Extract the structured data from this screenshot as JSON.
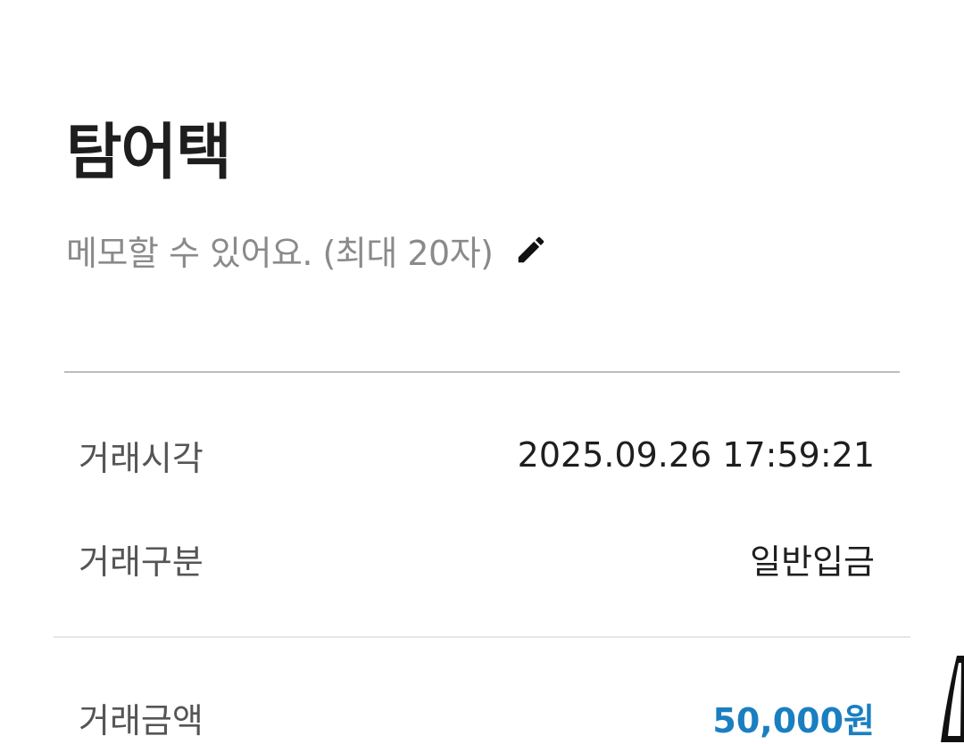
{
  "header": {
    "title": "탐어택",
    "memo_placeholder": "메모할 수 있어요. (최대 20자)",
    "edit_icon": "pencil-icon"
  },
  "details": {
    "time_label": "거래시각",
    "time_value": "2025.09.26 17:59:21",
    "type_label": "거래구분",
    "type_value": "일반입금",
    "amount_label": "거래금액",
    "amount_value": "50,000원"
  },
  "colors": {
    "amount": "#1a7fc1",
    "divider": "#bdbdbd",
    "memo_text": "#8a8a8a"
  }
}
